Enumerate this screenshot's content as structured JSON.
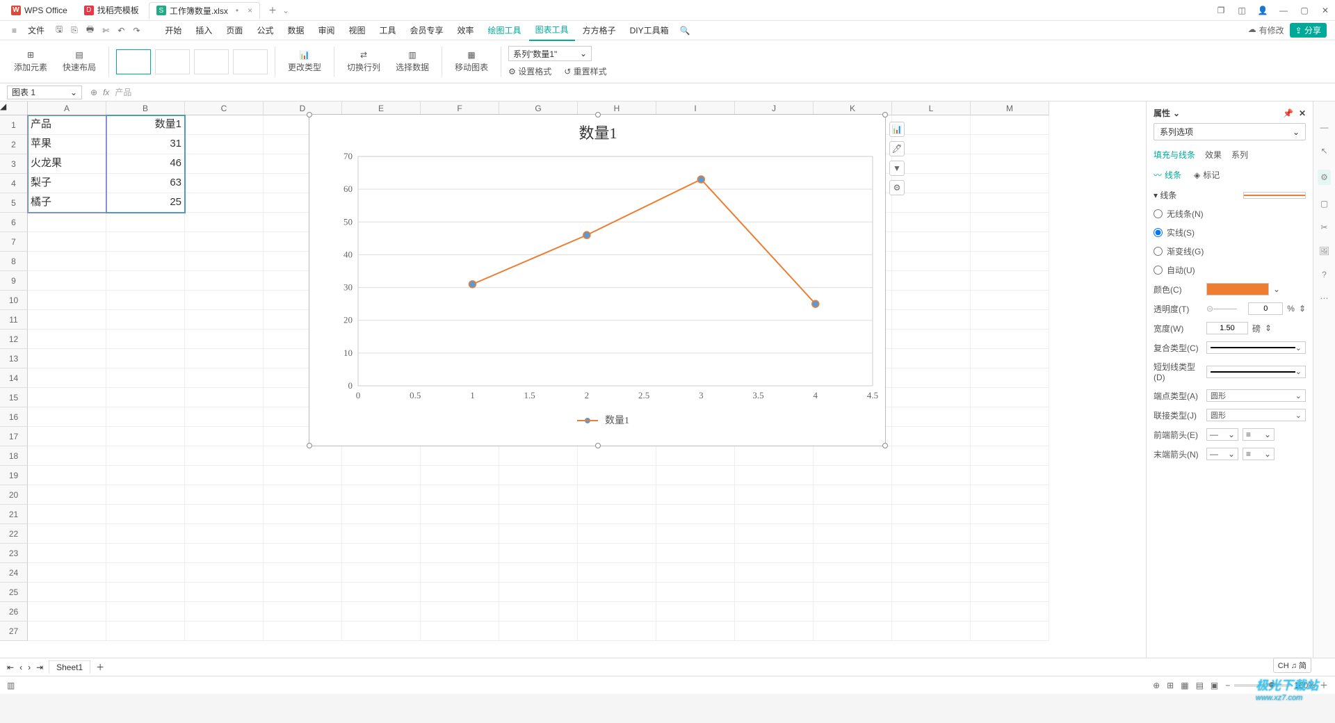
{
  "tabs": {
    "wps": "WPS Office",
    "template": "找稻壳模板",
    "doc": "工作簿数量.xlsx"
  },
  "menus": {
    "file": "文件",
    "start": "开始",
    "insert": "插入",
    "page": "页面",
    "formula": "公式",
    "data": "数据",
    "review": "审阅",
    "view": "视图",
    "tool": "工具",
    "member": "会员专享",
    "efficiency": "效率",
    "drawing": "绘图工具",
    "chart": "图表工具",
    "square": "方方格子",
    "diy": "DIY工具箱",
    "edit": "有修改",
    "share": "分享"
  },
  "ribbon": {
    "addel": "添加元素",
    "layout": "快速布局",
    "changetype": "更改类型",
    "swap": "切换行列",
    "seldata": "选择数据",
    "move": "移动图表",
    "setfmt": "设置格式",
    "resetfmt": "重置样式",
    "series_dd": "系列\"数量1\""
  },
  "namebox": "图表 1",
  "formula": "产品",
  "cols": [
    "A",
    "B",
    "C",
    "D",
    "E",
    "F",
    "G",
    "H",
    "I",
    "J",
    "K",
    "L",
    "M"
  ],
  "rows": [
    "1",
    "2",
    "3",
    "4",
    "5",
    "6",
    "7",
    "8",
    "9",
    "10",
    "11",
    "12",
    "13",
    "14",
    "15",
    "16",
    "17",
    "18",
    "19",
    "20",
    "21",
    "22",
    "23",
    "24",
    "25",
    "26",
    "27"
  ],
  "cells": {
    "A1": "产品",
    "B1": "数量1",
    "A2": "苹果",
    "B2": "31",
    "A3": "火龙果",
    "B3": "46",
    "A4": "梨子",
    "B4": "63",
    "A5": "橘子",
    "B5": "25"
  },
  "chart_data": {
    "type": "line",
    "title": "数量1",
    "x": [
      1,
      2,
      3,
      4
    ],
    "values": [
      31,
      46,
      63,
      25
    ],
    "series": [
      {
        "name": "数量1",
        "values": [
          31,
          46,
          63,
          25
        ]
      }
    ],
    "xticks": [
      "0",
      "0.5",
      "1",
      "1.5",
      "2",
      "2.5",
      "3",
      "3.5",
      "4",
      "4.5"
    ],
    "yticks": [
      "0",
      "10",
      "20",
      "30",
      "40",
      "50",
      "60",
      "70"
    ],
    "ylim": [
      0,
      70
    ],
    "xlim": [
      0,
      4.5
    ],
    "legend": "数量1"
  },
  "panel": {
    "title": "属性",
    "dd": "系列选项",
    "tabs": {
      "fill": "填充与线条",
      "effect": "效果",
      "series": "系列"
    },
    "sub": {
      "line": "线条",
      "mark": "标记"
    },
    "section": "线条",
    "radios": {
      "none": "无线条(N)",
      "solid": "实线(S)",
      "grad": "渐变线(G)",
      "auto": "自动(U)"
    },
    "labels": {
      "color": "颜色(C)",
      "trans": "透明度(T)",
      "width": "宽度(W)",
      "compound": "复合类型(C)",
      "dash": "短划线类型(D)",
      "cap": "端点类型(A)",
      "join": "联接类型(J)",
      "begin": "前端箭头(E)",
      "end": "末端箭头(N)"
    },
    "values": {
      "trans": "0",
      "transunit": "%",
      "width": "1.50",
      "widthunit": "磅",
      "cap": "圆形",
      "join": "圆形"
    }
  },
  "sheet": "Sheet1",
  "zoom": "160%",
  "ime": "CH ♫ 简",
  "watermark": "极光下载站",
  "watermark_url": "www.xz7.com"
}
